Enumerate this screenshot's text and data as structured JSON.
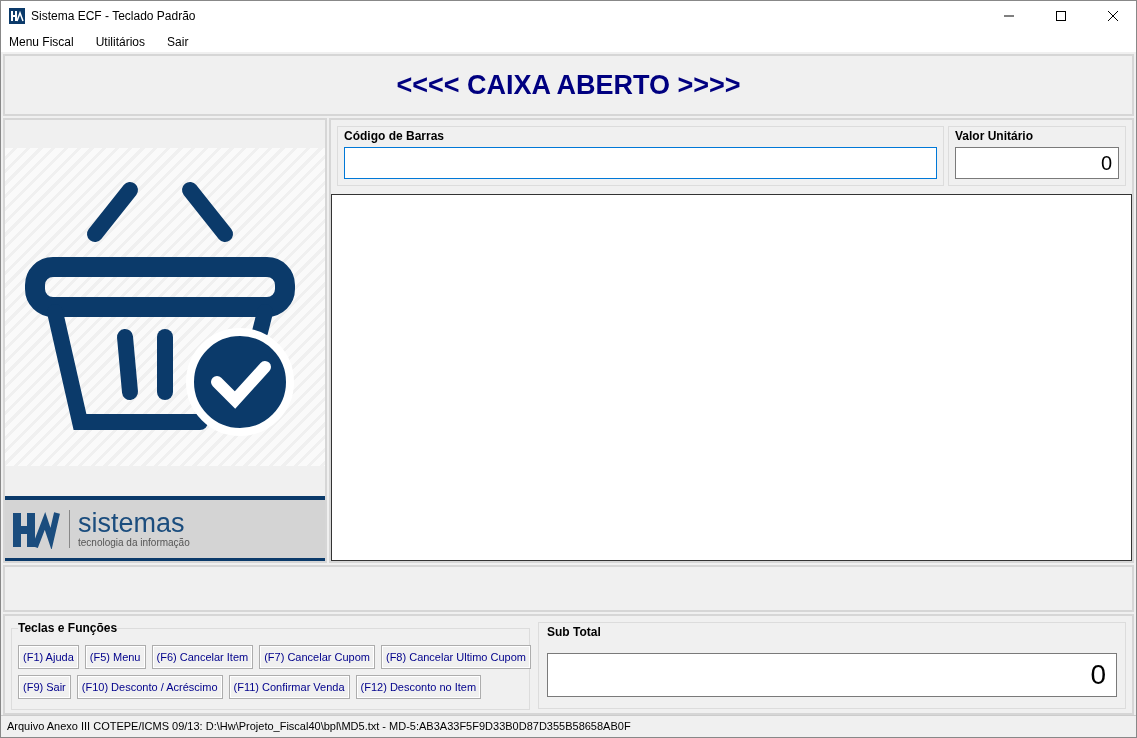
{
  "window": {
    "title": "Sistema ECF - Teclado Padrão"
  },
  "menu": [
    "Menu Fiscal",
    "Utilitários",
    "Sair"
  ],
  "banner": "<<<< CAIXA ABERTO >>>>",
  "logo": {
    "name": "sistemas",
    "tagline": "tecnologia da informação"
  },
  "barcode": {
    "label": "Código de Barras"
  },
  "unit_price": {
    "label": "Valor Unitário",
    "value": "0"
  },
  "keys": {
    "title": "Teclas e Funções",
    "first_row": [
      "(F1) Ajuda",
      "(F5) Menu",
      "(F6) Cancelar Item",
      "(F7) Cancelar Cupom",
      "(F8) Cancelar Ultimo Cupom"
    ],
    "second_row": [
      "(F9) Sair",
      "(F10) Desconto / Acréscimo",
      "(F11) Confirmar Venda",
      "(F12) Desconto no Item"
    ]
  },
  "subtotal": {
    "label": "Sub Total",
    "value": "0"
  },
  "status_bar": "Arquivo Anexo III COTEPE/ICMS 09/13: D:\\Hw\\Projeto_Fiscal40\\bpl\\MD5.txt - MD-5:AB3A33F5F9D33B0D87D355B58658AB0F"
}
